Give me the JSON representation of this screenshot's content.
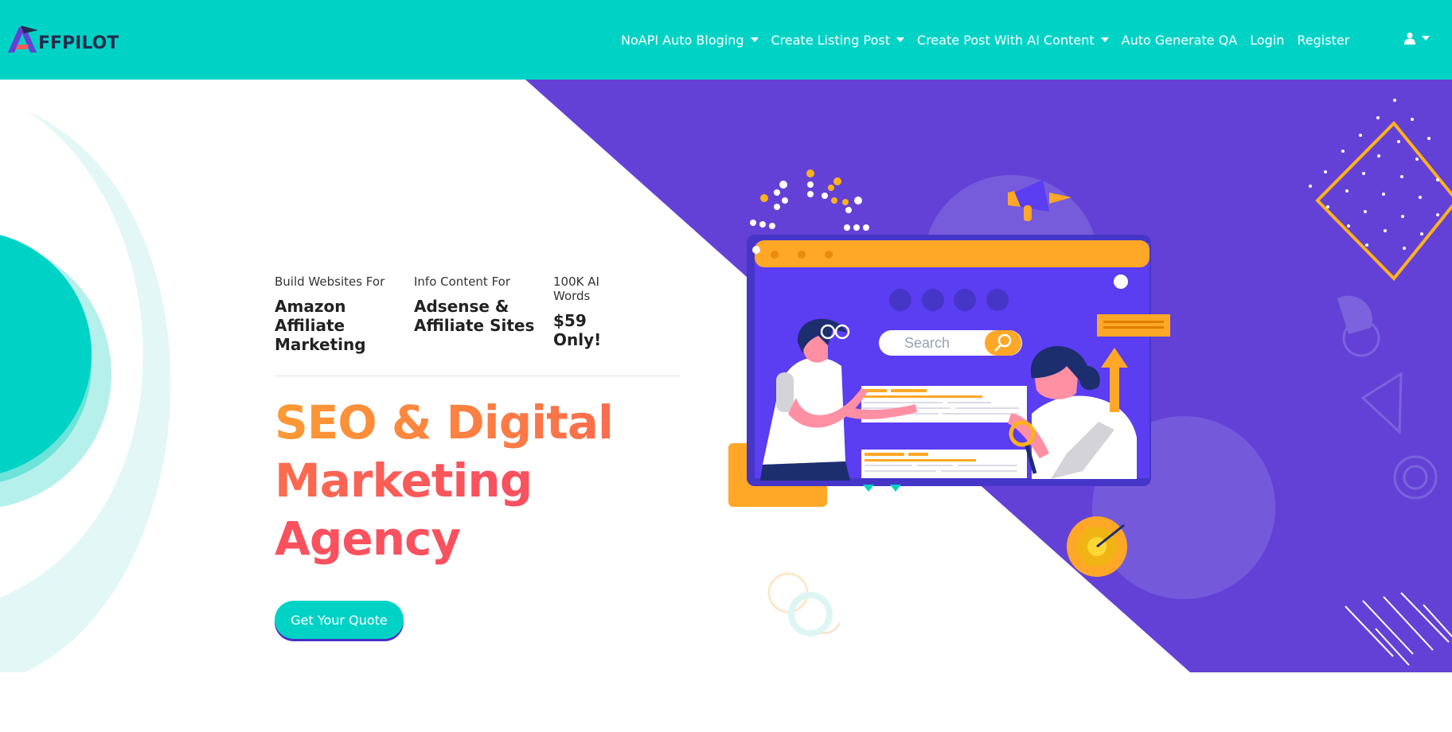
{
  "brand": {
    "logo_text": "FFPILOT"
  },
  "nav": {
    "items": [
      {
        "label": "NoAPI Auto Bloging",
        "dropdown": true
      },
      {
        "label": "Create Listing Post",
        "dropdown": true
      },
      {
        "label": "Create Post With AI Content",
        "dropdown": true
      },
      {
        "label": "Auto Generate QA",
        "dropdown": false
      },
      {
        "label": "Login",
        "dropdown": false
      },
      {
        "label": "Register",
        "dropdown": false
      }
    ],
    "user_icon": "user-icon"
  },
  "hero": {
    "features": [
      {
        "label": "Build Websites For",
        "value": "Amazon Affiliate Marketing"
      },
      {
        "label": "Info Content For",
        "value": "Adsense & Affiliate Sites"
      },
      {
        "label": "100K AI Words",
        "value": "$59 Only!"
      }
    ],
    "title": "SEO & Digital Marketing Agency",
    "cta_label": "Get Your Quote",
    "illustration": {
      "search_placeholder": "Search"
    }
  },
  "colors": {
    "navbar": "#00d3c6",
    "hero_purple": "#6441d6",
    "accent_orange": "#ffa726",
    "title_gradient_start": "#fc9a33",
    "title_gradient_end": "#f9515e",
    "cta": "#00d3c6"
  }
}
